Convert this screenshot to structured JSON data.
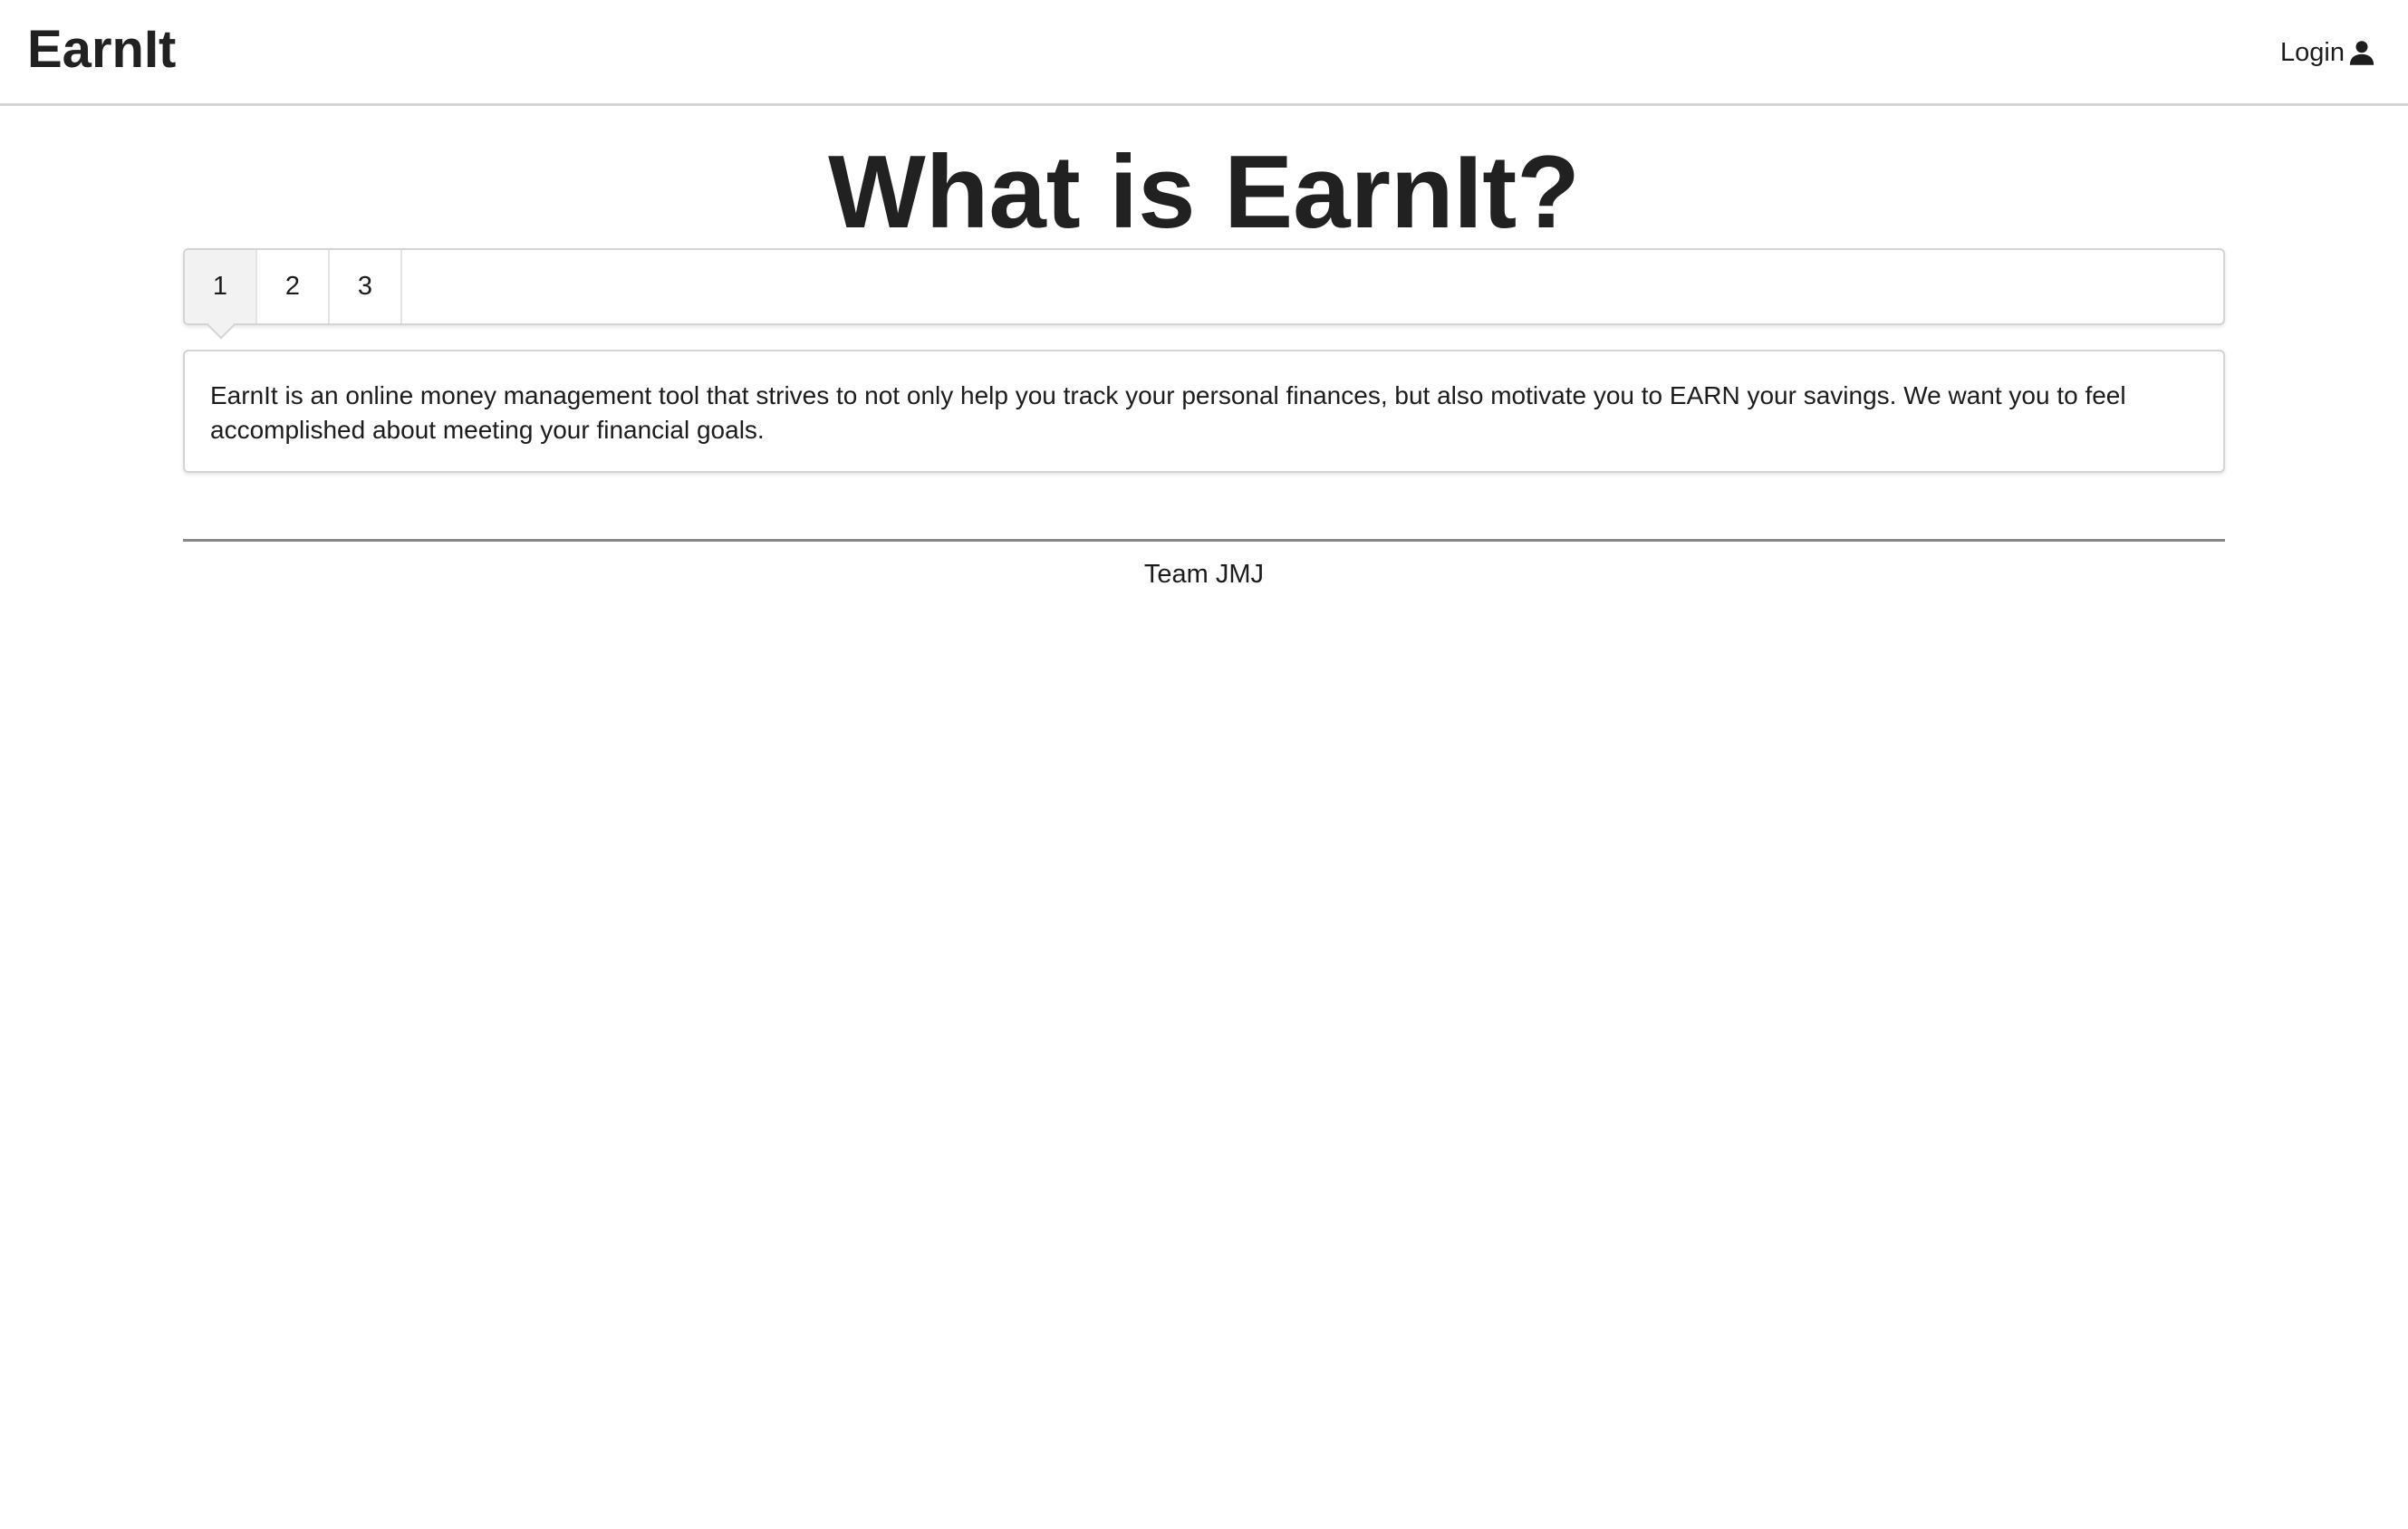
{
  "navbar": {
    "brand": "EarnIt",
    "login_label": "Login",
    "login_icon": "user-icon"
  },
  "main": {
    "title": "What is EarnIt?",
    "tabs": [
      {
        "label": "1",
        "active": true
      },
      {
        "label": "2",
        "active": false
      },
      {
        "label": "3",
        "active": false
      }
    ],
    "description": "EarnIt is an online money management tool that strives to not only help you track your personal finances, but also motivate you to EARN your savings. We want you to feel accomplished about meeting your financial goals."
  },
  "footer": {
    "text": "Team JMJ"
  }
}
